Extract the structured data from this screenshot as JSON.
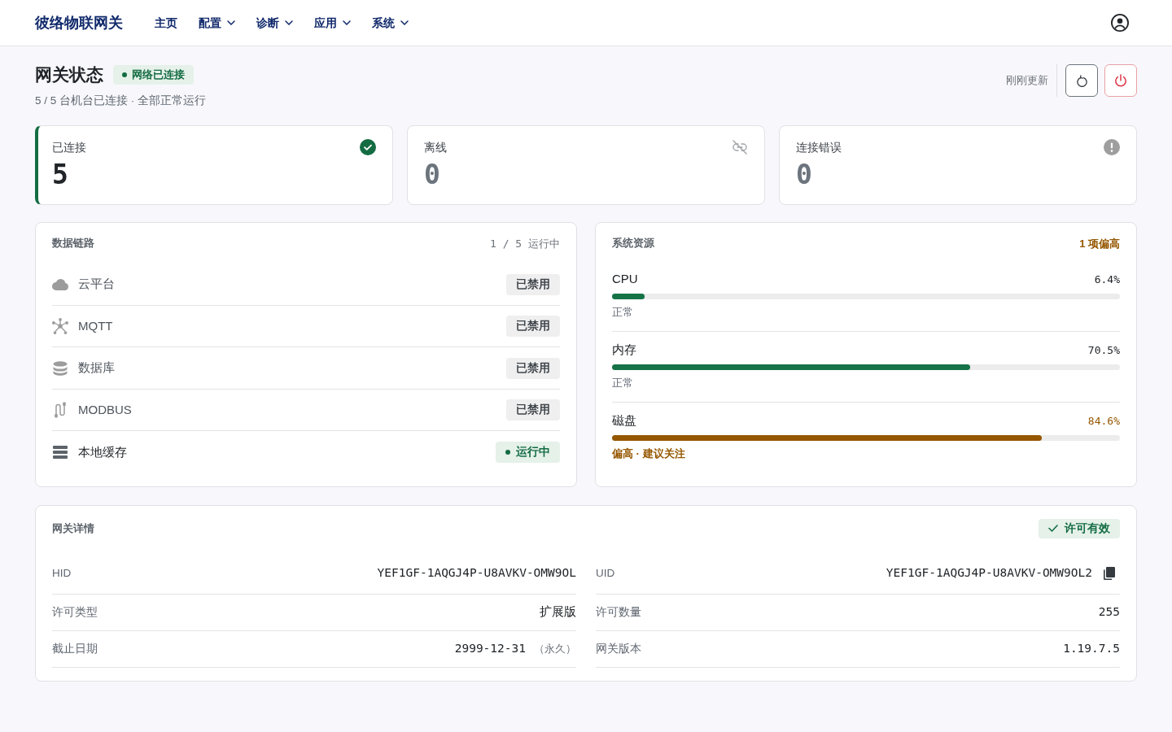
{
  "navbar": {
    "brand": "彼络物联网关",
    "items": [
      {
        "label": "主页",
        "dropdown": false
      },
      {
        "label": "配置",
        "dropdown": true
      },
      {
        "label": "诊断",
        "dropdown": true
      },
      {
        "label": "应用",
        "dropdown": true
      },
      {
        "label": "系统",
        "dropdown": true
      }
    ]
  },
  "header": {
    "title": "网关状态",
    "status_badge": "网络已连接",
    "subtitle": "5 / 5 台机台已连接 · 全部正常运行",
    "updated": "刚刚更新"
  },
  "stats": [
    {
      "kind": "connected",
      "label": "已连接",
      "value": "5",
      "highlighted": true
    },
    {
      "kind": "offline",
      "label": "离线",
      "value": "0",
      "highlighted": false
    },
    {
      "kind": "error",
      "label": "连接错误",
      "value": "0",
      "highlighted": false
    }
  ],
  "links": {
    "title": "数据链路",
    "summary": "1 / 5 运行中",
    "items": [
      {
        "kind": "cloud",
        "name": "云平台",
        "status": "已禁用",
        "running": false
      },
      {
        "kind": "mqtt",
        "name": "MQTT",
        "status": "已禁用",
        "running": false
      },
      {
        "kind": "database",
        "name": "数据库",
        "status": "已禁用",
        "running": false
      },
      {
        "kind": "modbus",
        "name": "MODBUS",
        "status": "已禁用",
        "running": false
      },
      {
        "kind": "cache",
        "name": "本地缓存",
        "status": "运行中",
        "running": true
      }
    ]
  },
  "resources": {
    "title": "系统资源",
    "summary": "1 项偏高",
    "items": [
      {
        "name": "CPU",
        "reading": "6.4%",
        "level": 0.064,
        "status": "正常",
        "high": false
      },
      {
        "name": "内存",
        "reading": "70.5%",
        "level": 0.705,
        "status": "正常",
        "high": false
      },
      {
        "name": "磁盘",
        "reading": "84.6%",
        "level": 0.846,
        "status": "偏高 · 建议关注",
        "high": true
      }
    ]
  },
  "details": {
    "title": "网关详情",
    "badge": "许可有效",
    "fields": [
      {
        "label": "HID",
        "value": "YEF1GF-1AQGJ4P-U8AVKV-OMW9OL",
        "copyable": false
      },
      {
        "label": "UID",
        "value": "YEF1GF-1AQGJ4P-U8AVKV-OMW9OL2",
        "copyable": true
      },
      {
        "label": "许可类型",
        "value": "扩展版",
        "copyable": false
      },
      {
        "label": "许可数量",
        "value": "255",
        "copyable": false
      },
      {
        "label": "截止日期",
        "value": "2999-12-31",
        "note": "（永久）",
        "copyable": false
      },
      {
        "label": "网关版本",
        "value": "1.19.7.5",
        "copyable": false
      }
    ]
  }
}
